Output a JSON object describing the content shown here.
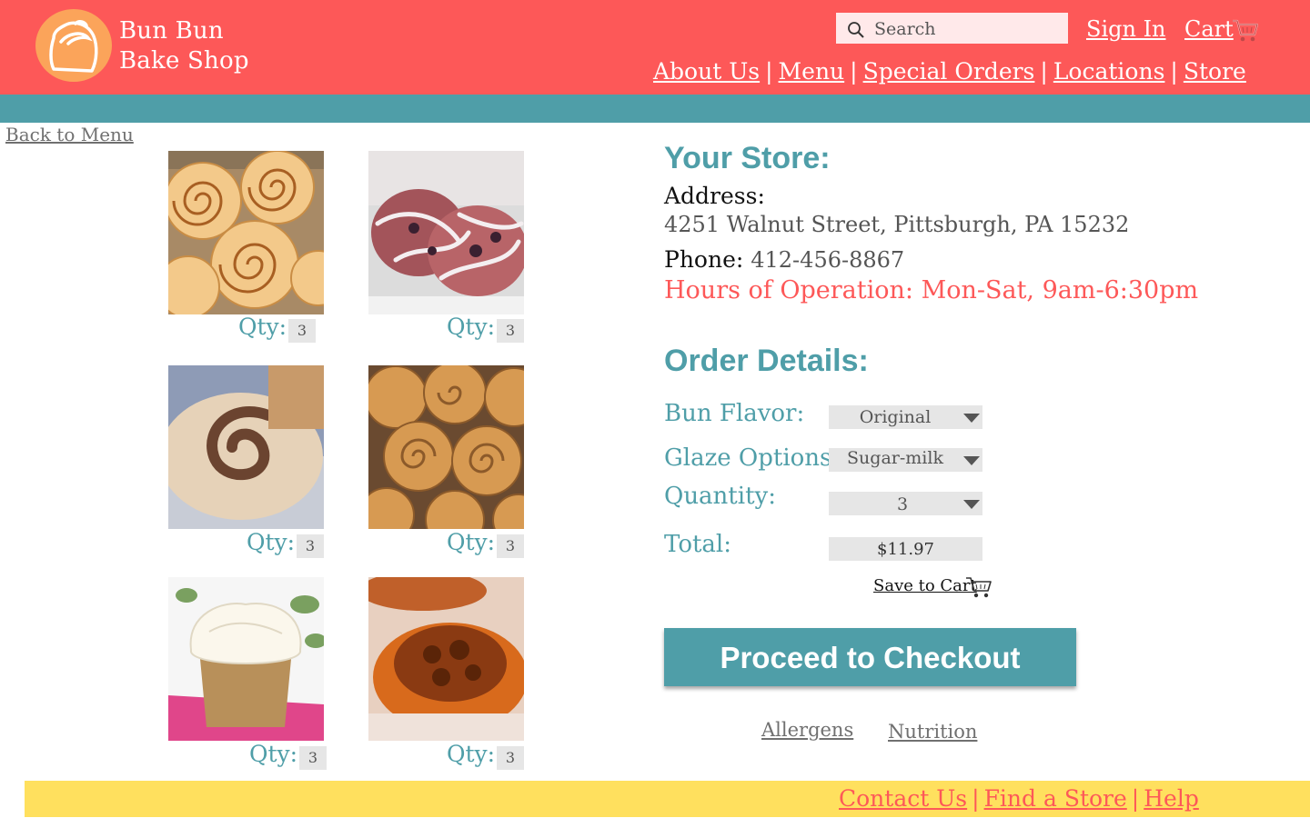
{
  "brand": {
    "line1": "Bun Bun",
    "line2": "Bake Shop",
    "logo_icon": "bun-logo-icon"
  },
  "header": {
    "search_placeholder": "Search",
    "sign_in": "Sign In",
    "cart": "Cart",
    "nav": [
      "About Us",
      "Menu",
      "Special Orders",
      "Locations",
      "Store"
    ],
    "separator": "|"
  },
  "back_link": "Back to Menu",
  "products": [
    {
      "image": "cinnamon-rolls-tray-photo",
      "qty_label": "Qty:",
      "qty": "3"
    },
    {
      "image": "glazed-berry-rolls-photo",
      "qty_label": "Qty:",
      "qty": "3"
    },
    {
      "image": "chocolate-swirl-bun-photo",
      "qty_label": "Qty:",
      "qty": "3"
    },
    {
      "image": "baked-cinnamon-rolls-photo",
      "qty_label": "Qty:",
      "qty": "3"
    },
    {
      "image": "frosted-cupcake-photo",
      "qty_label": "Qty:",
      "qty": "3"
    },
    {
      "image": "pecan-sticky-bun-photo",
      "qty_label": "Qty:",
      "qty": "3"
    }
  ],
  "store": {
    "heading": "Your Store:",
    "address_label": "Address:",
    "address": "4251 Walnut Street, Pittsburgh, PA 15232",
    "phone_label": "Phone:",
    "phone": "412-456-8867",
    "hours": "Hours of Operation: Mon-Sat, 9am-6:30pm"
  },
  "order": {
    "heading": "Order Details:",
    "flavor_label": "Bun Flavor:",
    "flavor_value": "Original",
    "glaze_label": "Glaze Options:",
    "glaze_value": "Sugar-milk",
    "quantity_label": "Quantity:",
    "quantity_value": "3",
    "total_label": "Total:",
    "total_value": "$11.97",
    "save_to_cart": "Save to Cart",
    "checkout": "Proceed to Checkout",
    "allergens": "Allergens",
    "nutrition": "Nutrition"
  },
  "footer": {
    "links": [
      "Contact Us",
      "Find a Store",
      "Help"
    ],
    "separator": "|"
  },
  "colors": {
    "header": "#fd5858",
    "band": "#4f9ea8",
    "logo": "#fba45a",
    "footer": "#ffe05e",
    "accent_teal": "#4f9ea8"
  }
}
